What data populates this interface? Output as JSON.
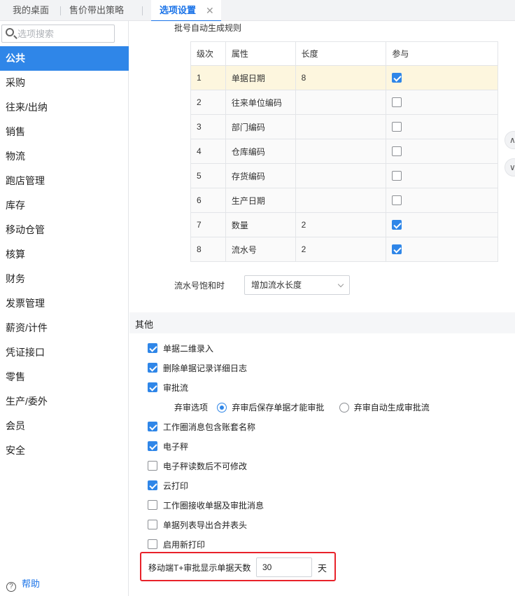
{
  "tabs": [
    {
      "label": "我的桌面",
      "active": false
    },
    {
      "label": "售价带出策略",
      "active": false
    },
    {
      "label": "选项设置",
      "active": true,
      "close": "✕"
    }
  ],
  "sidebar": {
    "search_placeholder": "选项搜索",
    "items": [
      "公共",
      "采购",
      "往来/出纳",
      "销售",
      "物流",
      "跑店管理",
      "库存",
      "移动仓管",
      "核算",
      "财务",
      "发票管理",
      "薪资/计件",
      "凭证接口",
      "零售",
      "生产/委外",
      "会员",
      "安全"
    ],
    "active_index": 0,
    "help_label": "帮助"
  },
  "batch": {
    "title": "批号自动生成规则",
    "headers": [
      "级次",
      "属性",
      "长度",
      "参与"
    ],
    "rows": [
      {
        "level": "1",
        "attr": "单据日期",
        "length": "8",
        "checked": true,
        "selected": true
      },
      {
        "level": "2",
        "attr": "往来单位编码",
        "length": "",
        "checked": false
      },
      {
        "level": "3",
        "attr": "部门编码",
        "length": "",
        "checked": false
      },
      {
        "level": "4",
        "attr": "仓库编码",
        "length": "",
        "checked": false
      },
      {
        "level": "5",
        "attr": "存货编码",
        "length": "",
        "checked": false
      },
      {
        "level": "6",
        "attr": "生产日期",
        "length": "",
        "checked": false
      },
      {
        "level": "7",
        "attr": "数量",
        "length": "2",
        "checked": true
      },
      {
        "level": "8",
        "attr": "流水号",
        "length": "2",
        "checked": true
      }
    ],
    "saturation_label": "流水号饱和时",
    "saturation_value": "增加流水长度"
  },
  "other": {
    "title": "其他",
    "options": [
      {
        "label": "单据二维录入",
        "checked": true
      },
      {
        "label": "删除单据记录详细日志",
        "checked": true
      },
      {
        "label": "审批流",
        "checked": true
      },
      {
        "label": "工作圈消息包含账套名称",
        "checked": true
      },
      {
        "label": "电子秤",
        "checked": true
      },
      {
        "label": "电子秤读数后不可修改",
        "checked": false
      },
      {
        "label": "云打印",
        "checked": true
      },
      {
        "label": "工作圈接收单据及审批消息",
        "checked": false
      },
      {
        "label": "单据列表导出合并表头",
        "checked": false
      },
      {
        "label": "启用新打印",
        "checked": false
      }
    ],
    "abandon": {
      "label": "弃审选项",
      "options": [
        "弃审后保存单据才能审批",
        "弃审自动生成审批流"
      ],
      "selected": 0
    },
    "mobile_days": {
      "label": "移动端T+审批显示单据天数",
      "value": "30",
      "unit": "天"
    }
  },
  "colors": {
    "accent": "#2f86e8",
    "highlight_border": "#e8222a",
    "selected_row": "#fdf6de"
  }
}
